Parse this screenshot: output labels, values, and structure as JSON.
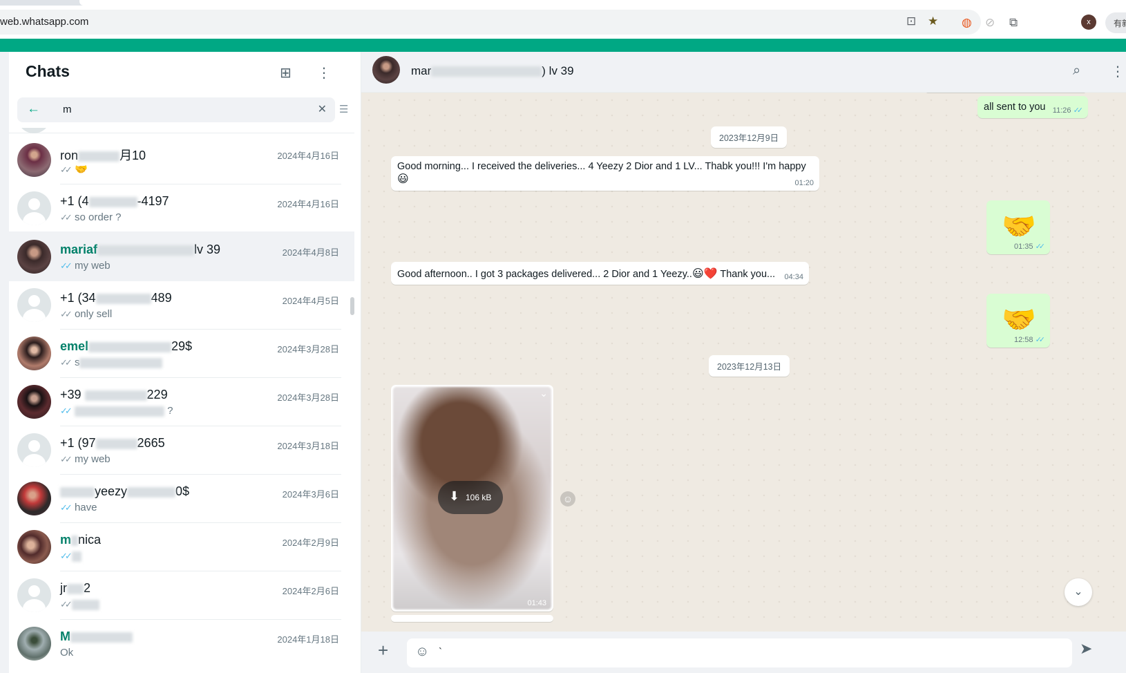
{
  "browser": {
    "url": "web.whatsapp.com",
    "profile_initial": "x",
    "more_label": "有新"
  },
  "sidebar": {
    "title": "Chats",
    "search_value": "m",
    "chats": [
      {
        "name_prefix": "ron",
        "name_suffix": "月10",
        "date": "2024年4月16日",
        "preview": "🤝",
        "tick": "✓✓",
        "read": false
      },
      {
        "name_prefix": "+1 (4",
        "name_suffix": "-4197",
        "date": "2024年4月16日",
        "preview": "so order ?",
        "tick": "✓✓",
        "read": false
      },
      {
        "name_prefix": "mariaf",
        "name_suffix": "lv 39",
        "date": "2024年4月8日",
        "preview": "my web",
        "tick": "✓✓",
        "read": true
      },
      {
        "name_prefix": "+1 (34",
        "name_suffix": "489",
        "date": "2024年4月5日",
        "preview": "only sell",
        "tick": "✓✓",
        "read": false
      },
      {
        "name_prefix": "emel",
        "name_suffix": "29$",
        "date": "2024年3月28日",
        "preview": "s",
        "tick": "✓✓",
        "read": false
      },
      {
        "name_prefix": "+39 ",
        "name_suffix": "229",
        "date": "2024年3月28日",
        "preview": "?",
        "tick": "✓✓",
        "read": true
      },
      {
        "name_prefix": "+1 (97",
        "name_suffix": "2665",
        "date": "2024年3月18日",
        "preview": "my web",
        "tick": "✓✓",
        "read": false
      },
      {
        "name_prefix": "yeezy",
        "name_suffix": "0$",
        "date": "2024年3月6日",
        "preview": "have",
        "tick": "✓✓",
        "read": true
      },
      {
        "name_prefix": "m",
        "name_suffix": "nica",
        "date": "2024年2月9日",
        "preview": "",
        "tick": "✓✓",
        "read": true
      },
      {
        "name_prefix": "jr",
        "name_suffix": "2",
        "date": "2024年2月6日",
        "preview": "",
        "tick": "✓✓",
        "read": false
      },
      {
        "name_prefix": "M",
        "name_suffix": "",
        "date": "2024年1月18日",
        "preview": "Ok",
        "tick": "",
        "read": false
      }
    ]
  },
  "conversation": {
    "name_prefix": "mar",
    "name_suffix": ") lv 39",
    "messages": {
      "m1_text": "all sent to you",
      "m1_time": "11:26",
      "d1": "2023年12月9日",
      "m2_text": "Good morning... I received the deliveries... 4 Yeezy 2 Dior and 1 LV... Thabk you!!! I'm happy",
      "m2_emoji": "😃",
      "m2_time": "01:20",
      "m3_emoji": "🤝",
      "m3_time": "01:35",
      "m4_text": "Good afternoon.. I got 3 packages delivered... 2 Dior and 1 Yeezy..",
      "m4_emoji": "😃❤️",
      "m4_tail": " Thank you...",
      "m4_time": "04:34",
      "m5_emoji": "🤝",
      "m5_time": "12:58",
      "d2": "2023年12月13日",
      "media_size": "106 kB",
      "media_time": "01:43"
    },
    "compose_value": "`"
  }
}
